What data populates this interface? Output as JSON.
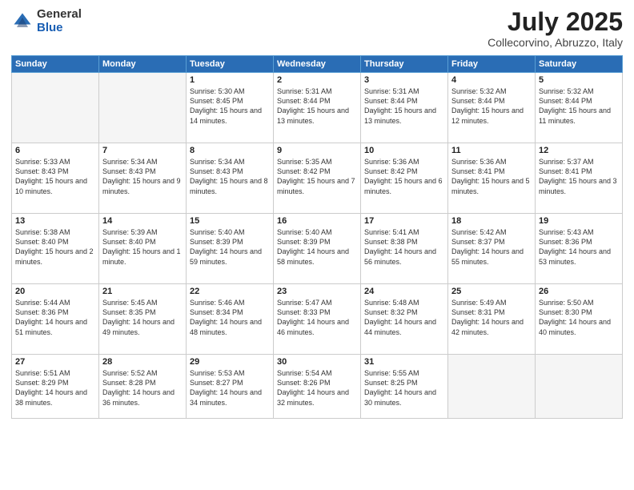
{
  "logo": {
    "general": "General",
    "blue": "Blue"
  },
  "header": {
    "month": "July 2025",
    "location": "Collecorvino, Abruzzo, Italy"
  },
  "weekdays": [
    "Sunday",
    "Monday",
    "Tuesday",
    "Wednesday",
    "Thursday",
    "Friday",
    "Saturday"
  ],
  "weeks": [
    [
      {
        "day": "",
        "sunrise": "",
        "sunset": "",
        "daylight": ""
      },
      {
        "day": "",
        "sunrise": "",
        "sunset": "",
        "daylight": ""
      },
      {
        "day": "1",
        "sunrise": "Sunrise: 5:30 AM",
        "sunset": "Sunset: 8:45 PM",
        "daylight": "Daylight: 15 hours and 14 minutes."
      },
      {
        "day": "2",
        "sunrise": "Sunrise: 5:31 AM",
        "sunset": "Sunset: 8:44 PM",
        "daylight": "Daylight: 15 hours and 13 minutes."
      },
      {
        "day": "3",
        "sunrise": "Sunrise: 5:31 AM",
        "sunset": "Sunset: 8:44 PM",
        "daylight": "Daylight: 15 hours and 13 minutes."
      },
      {
        "day": "4",
        "sunrise": "Sunrise: 5:32 AM",
        "sunset": "Sunset: 8:44 PM",
        "daylight": "Daylight: 15 hours and 12 minutes."
      },
      {
        "day": "5",
        "sunrise": "Sunrise: 5:32 AM",
        "sunset": "Sunset: 8:44 PM",
        "daylight": "Daylight: 15 hours and 11 minutes."
      }
    ],
    [
      {
        "day": "6",
        "sunrise": "Sunrise: 5:33 AM",
        "sunset": "Sunset: 8:43 PM",
        "daylight": "Daylight: 15 hours and 10 minutes."
      },
      {
        "day": "7",
        "sunrise": "Sunrise: 5:34 AM",
        "sunset": "Sunset: 8:43 PM",
        "daylight": "Daylight: 15 hours and 9 minutes."
      },
      {
        "day": "8",
        "sunrise": "Sunrise: 5:34 AM",
        "sunset": "Sunset: 8:43 PM",
        "daylight": "Daylight: 15 hours and 8 minutes."
      },
      {
        "day": "9",
        "sunrise": "Sunrise: 5:35 AM",
        "sunset": "Sunset: 8:42 PM",
        "daylight": "Daylight: 15 hours and 7 minutes."
      },
      {
        "day": "10",
        "sunrise": "Sunrise: 5:36 AM",
        "sunset": "Sunset: 8:42 PM",
        "daylight": "Daylight: 15 hours and 6 minutes."
      },
      {
        "day": "11",
        "sunrise": "Sunrise: 5:36 AM",
        "sunset": "Sunset: 8:41 PM",
        "daylight": "Daylight: 15 hours and 5 minutes."
      },
      {
        "day": "12",
        "sunrise": "Sunrise: 5:37 AM",
        "sunset": "Sunset: 8:41 PM",
        "daylight": "Daylight: 15 hours and 3 minutes."
      }
    ],
    [
      {
        "day": "13",
        "sunrise": "Sunrise: 5:38 AM",
        "sunset": "Sunset: 8:40 PM",
        "daylight": "Daylight: 15 hours and 2 minutes."
      },
      {
        "day": "14",
        "sunrise": "Sunrise: 5:39 AM",
        "sunset": "Sunset: 8:40 PM",
        "daylight": "Daylight: 15 hours and 1 minute."
      },
      {
        "day": "15",
        "sunrise": "Sunrise: 5:40 AM",
        "sunset": "Sunset: 8:39 PM",
        "daylight": "Daylight: 14 hours and 59 minutes."
      },
      {
        "day": "16",
        "sunrise": "Sunrise: 5:40 AM",
        "sunset": "Sunset: 8:39 PM",
        "daylight": "Daylight: 14 hours and 58 minutes."
      },
      {
        "day": "17",
        "sunrise": "Sunrise: 5:41 AM",
        "sunset": "Sunset: 8:38 PM",
        "daylight": "Daylight: 14 hours and 56 minutes."
      },
      {
        "day": "18",
        "sunrise": "Sunrise: 5:42 AM",
        "sunset": "Sunset: 8:37 PM",
        "daylight": "Daylight: 14 hours and 55 minutes."
      },
      {
        "day": "19",
        "sunrise": "Sunrise: 5:43 AM",
        "sunset": "Sunset: 8:36 PM",
        "daylight": "Daylight: 14 hours and 53 minutes."
      }
    ],
    [
      {
        "day": "20",
        "sunrise": "Sunrise: 5:44 AM",
        "sunset": "Sunset: 8:36 PM",
        "daylight": "Daylight: 14 hours and 51 minutes."
      },
      {
        "day": "21",
        "sunrise": "Sunrise: 5:45 AM",
        "sunset": "Sunset: 8:35 PM",
        "daylight": "Daylight: 14 hours and 49 minutes."
      },
      {
        "day": "22",
        "sunrise": "Sunrise: 5:46 AM",
        "sunset": "Sunset: 8:34 PM",
        "daylight": "Daylight: 14 hours and 48 minutes."
      },
      {
        "day": "23",
        "sunrise": "Sunrise: 5:47 AM",
        "sunset": "Sunset: 8:33 PM",
        "daylight": "Daylight: 14 hours and 46 minutes."
      },
      {
        "day": "24",
        "sunrise": "Sunrise: 5:48 AM",
        "sunset": "Sunset: 8:32 PM",
        "daylight": "Daylight: 14 hours and 44 minutes."
      },
      {
        "day": "25",
        "sunrise": "Sunrise: 5:49 AM",
        "sunset": "Sunset: 8:31 PM",
        "daylight": "Daylight: 14 hours and 42 minutes."
      },
      {
        "day": "26",
        "sunrise": "Sunrise: 5:50 AM",
        "sunset": "Sunset: 8:30 PM",
        "daylight": "Daylight: 14 hours and 40 minutes."
      }
    ],
    [
      {
        "day": "27",
        "sunrise": "Sunrise: 5:51 AM",
        "sunset": "Sunset: 8:29 PM",
        "daylight": "Daylight: 14 hours and 38 minutes."
      },
      {
        "day": "28",
        "sunrise": "Sunrise: 5:52 AM",
        "sunset": "Sunset: 8:28 PM",
        "daylight": "Daylight: 14 hours and 36 minutes."
      },
      {
        "day": "29",
        "sunrise": "Sunrise: 5:53 AM",
        "sunset": "Sunset: 8:27 PM",
        "daylight": "Daylight: 14 hours and 34 minutes."
      },
      {
        "day": "30",
        "sunrise": "Sunrise: 5:54 AM",
        "sunset": "Sunset: 8:26 PM",
        "daylight": "Daylight: 14 hours and 32 minutes."
      },
      {
        "day": "31",
        "sunrise": "Sunrise: 5:55 AM",
        "sunset": "Sunset: 8:25 PM",
        "daylight": "Daylight: 14 hours and 30 minutes."
      },
      {
        "day": "",
        "sunrise": "",
        "sunset": "",
        "daylight": ""
      },
      {
        "day": "",
        "sunrise": "",
        "sunset": "",
        "daylight": ""
      }
    ]
  ]
}
